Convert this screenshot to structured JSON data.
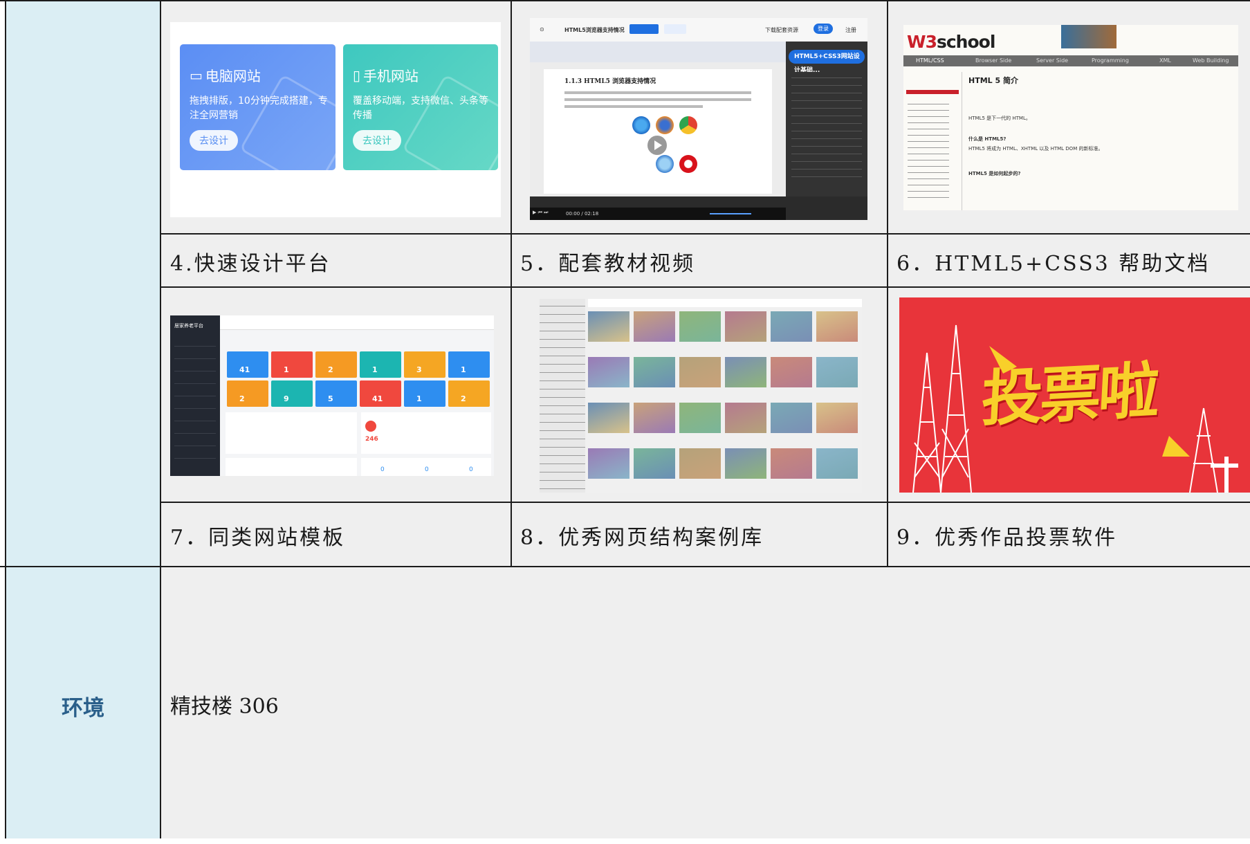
{
  "rows": [
    {
      "captions": [
        "4.快速设计平台",
        "5．配套教材视频",
        "6．HTML5+CSS3 帮助文档"
      ]
    },
    {
      "captions": [
        "7．同类网站模板",
        "8．优秀网页结构案例库",
        "9．优秀作品投票软件"
      ]
    }
  ],
  "environment": {
    "label": "环境",
    "value": "精技楼 306"
  },
  "screenshots": {
    "design_platform": {
      "cards": [
        {
          "title": "电脑网站",
          "desc": "拖拽排版，10分钟完成搭建，专注全网营销",
          "button": "去设计",
          "color": "#5a8ff2"
        },
        {
          "title": "手机网站",
          "desc": "覆盖移动端，支持微信、头条等传播",
          "button": "去设计",
          "color": "#3cc7bf"
        }
      ]
    },
    "video": {
      "title": "HTML5浏览器支持情况",
      "page_heading": "1.1.3  HTML5 浏览器支持情况",
      "side_heading": "HTML5+CSS3网站设计基础...",
      "time": "00:00 / 02:18",
      "download": "下载配套资源",
      "login": "登录",
      "register": "注册"
    },
    "w3school": {
      "logo": "W3school",
      "nav": [
        "HTML/CSS",
        "Browser Side",
        "Server Side",
        "Programming",
        "XML",
        "Web Building"
      ],
      "heading": "HTML 5 简介",
      "lines": [
        "HTML5 是下一代的 HTML。",
        "什么是 HTML5?",
        "HTML5 将成为 HTML、XHTML 以及 HTML DOM 的新标准。",
        "HTML5 是如何起步的?"
      ]
    },
    "dashboard": {
      "title": "居家养老平台",
      "tiles": [
        "41",
        "1",
        "2",
        "1",
        "3",
        "1",
        "2",
        "9",
        "5",
        "41",
        "1",
        "2"
      ],
      "sos": "246",
      "stats": [
        "0",
        "0",
        "0"
      ]
    },
    "vote": {
      "text": "投票啦"
    }
  },
  "colors": {
    "label_bg": "#dbeef4",
    "content_bg": "#efefef",
    "label_text": "#2a5f8a"
  }
}
